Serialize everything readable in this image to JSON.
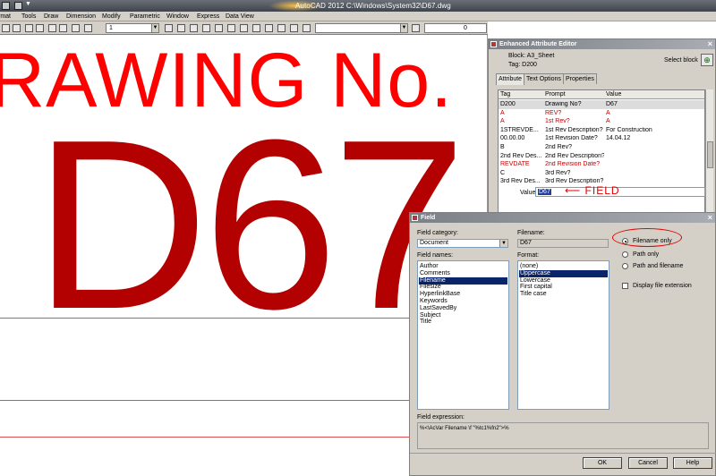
{
  "window": {
    "title": "AutoCAD 2012   C:\\Windows\\System32\\D67.dwg",
    "quick_access_arrow": "▼"
  },
  "menu": [
    "rmat",
    "Tools",
    "Draw",
    "Dimension",
    "Modify",
    "Parametric",
    "Window",
    "Express",
    "Data View"
  ],
  "toolbar": {
    "layer_value": "1",
    "layer_right_value": "0"
  },
  "canvas": {
    "heading_text": "RAWING No.",
    "drawing_number": "D67",
    "colors": {
      "heading": "#ff0000",
      "number": "#b30000",
      "line_blue": "#4f7fd1",
      "line_red": "#e05050"
    }
  },
  "attribute_editor": {
    "title": "Enhanced Attribute Editor",
    "block_label": "Block: A3_Sheet",
    "tag_label": "Tag: D200",
    "select_block_label": "Select block",
    "tabs": [
      "Attribute",
      "Text Options",
      "Properties"
    ],
    "columns": [
      "Tag",
      "Prompt",
      "Value"
    ],
    "rows": [
      {
        "tag": "D200",
        "prompt": "Drawing No?",
        "value": "D67",
        "style": "selected"
      },
      {
        "tag": "A",
        "prompt": "REV?",
        "value": "A",
        "style": "red"
      },
      {
        "tag": "A",
        "prompt": "1st Rev?",
        "value": "A",
        "style": "red"
      },
      {
        "tag": "1STREVDE...",
        "prompt": "1st Rev Description?",
        "value": "For Construction",
        "style": "normal"
      },
      {
        "tag": "00.00.00",
        "prompt": "1st Revision Date?",
        "value": "14.04.12",
        "style": "normal"
      },
      {
        "tag": "B",
        "prompt": "2nd Rev?",
        "value": "",
        "style": "normal"
      },
      {
        "tag": "2nd Rev Des...",
        "prompt": "2nd Rev Description?",
        "value": "",
        "style": "normal"
      },
      {
        "tag": "REVDATE",
        "prompt": "2nd Revision Date?",
        "value": "",
        "style": "red"
      },
      {
        "tag": "C",
        "prompt": "3rd Rev?",
        "value": "",
        "style": "normal"
      },
      {
        "tag": "3rd Rev Des...",
        "prompt": "3rd Rev Description?",
        "value": "",
        "style": "normal"
      }
    ],
    "value_label": "Value:",
    "value": "D67",
    "annotation": "⟵ FIELD"
  },
  "field_dialog": {
    "title": "Field",
    "category_label": "Field category:",
    "category_value": "Document",
    "names_label": "Field names:",
    "field_names": [
      "Author",
      "Comments",
      "Filename",
      "Filesize",
      "HyperlinkBase",
      "Keywords",
      "LastSavedBy",
      "Subject",
      "Title"
    ],
    "selected_field_name": "Filename",
    "filename_label": "Filename:",
    "filename_value": "D67",
    "format_label": "Format:",
    "formats": [
      "(none)",
      "Uppercase",
      "Lowercase",
      "First capital",
      "Title case"
    ],
    "selected_format": "Uppercase",
    "options": [
      "Filename only",
      "Path only",
      "Path and filename"
    ],
    "selected_option": "Filename only",
    "extension_label": "Display file extension",
    "expression_label": "Field expression:",
    "expression": "%<\\AcVar Filename \\f \"%tc1%fn2\">%",
    "buttons": {
      "ok": "OK",
      "cancel": "Cancel",
      "help": "Help"
    }
  }
}
